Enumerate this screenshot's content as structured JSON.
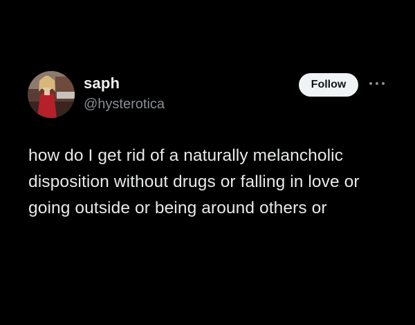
{
  "author": {
    "display_name": "saph",
    "handle": "@hysterotica"
  },
  "actions": {
    "follow_label": "Follow",
    "more_icon": "more-horizontal-icon"
  },
  "tweet": {
    "lines": [
      "how do I get rid of a naturally melancholic",
      "disposition without drugs or falling in love or",
      "going outside or being around others or"
    ]
  },
  "colors": {
    "background": "#000000",
    "text": "#e7e9ea",
    "secondary_text": "#8b8f94",
    "button_bg": "#eff3f4",
    "button_text": "#0f1419"
  }
}
